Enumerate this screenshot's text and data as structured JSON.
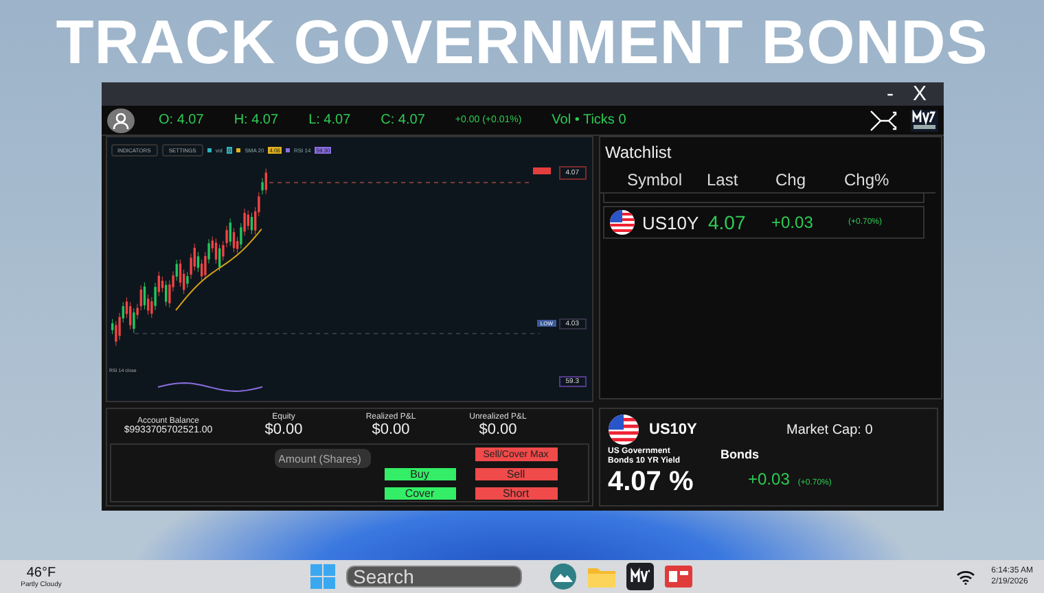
{
  "banner": {
    "title": "TRACK GOVERNMENT BONDS"
  },
  "window": {
    "minimize": "-",
    "close": "X"
  },
  "quote_bar": {
    "open": "O: 4.07",
    "high": "H: 4.07",
    "low": "L: 4.07",
    "close": "C: 4.07",
    "change": "+0.00 (+0.01%)",
    "volume": "Vol • Ticks  0"
  },
  "chart": {
    "buttons": [
      "INDICATORS",
      "SETTINGS"
    ],
    "legend": [
      {
        "label": "vol",
        "value": "0",
        "color": "#2bb3c0"
      },
      {
        "label": "SMA 20",
        "value": "4.06",
        "color": "#e0b020"
      },
      {
        "label": "RSI 14",
        "value": "59.30",
        "color": "#8a6ee0"
      }
    ],
    "last_price": "4.07",
    "low_tag": {
      "label": "LOW",
      "value": "4.03"
    },
    "rsi_pane": {
      "title": "RSI 14 close",
      "value": "59.3"
    }
  },
  "watchlist": {
    "title": "Watchlist",
    "columns": [
      "Symbol",
      "Last",
      "Chg",
      "Chg%"
    ],
    "rows": [
      {
        "symbol": "US10Y",
        "last": "4.07",
        "chg": "+0.03",
        "chg_pct": "(+0.70%)"
      }
    ]
  },
  "account": {
    "stats": [
      {
        "label": "Account Balance",
        "value": "$9933705702521.00"
      },
      {
        "label": "Equity",
        "value": "$0.00"
      },
      {
        "label": "Realized P&L",
        "value": "$0.00"
      },
      {
        "label": "Unrealized P&L",
        "value": "$0.00"
      }
    ],
    "amount_placeholder": "Amount (Shares)",
    "buttons": [
      {
        "label": "Sell/Cover Max",
        "kind": "sell"
      },
      {
        "label": "Buy",
        "kind": "buy"
      },
      {
        "label": "Sell",
        "kind": "sell"
      },
      {
        "label": "Cover",
        "kind": "buy"
      },
      {
        "label": "Short",
        "kind": "sell"
      }
    ]
  },
  "detail": {
    "symbol": "US10Y",
    "market_cap": "Market Cap: 0",
    "description": "US Government Bonds 10 YR Yield",
    "category": "Bonds",
    "price": "4.07 %",
    "change": "+0.03",
    "change_pct": "(+0.70%)"
  },
  "taskbar": {
    "temperature": "46°F",
    "condition": "Partly Cloudy",
    "search_placeholder": "Search",
    "time": "6:14:35 AM",
    "date": "2/19/2026"
  }
}
